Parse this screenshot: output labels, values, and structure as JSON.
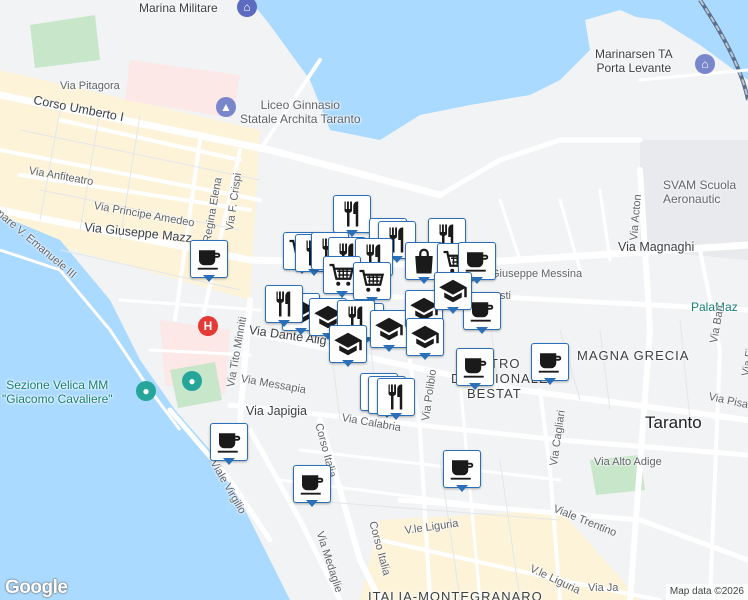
{
  "labels": {
    "marina_militare": "Marina Militare",
    "marinarsen_1": "Marinarsen TA",
    "marinarsen_2": "Porta Levante",
    "via_pitagora": "Via Pitagora",
    "corso_umberto": "Corso Umberto I",
    "liceo_1": "Liceo Ginnasio",
    "liceo_2": "Statale Archita Taranto",
    "svam_1": "SVAM Scuola",
    "svam_2": "Aeronautic",
    "via_anfiteatro": "Via Anfiteatro",
    "via_regina_elena": "Via Regina Elena",
    "via_f_crispi": "Via F. Crispi",
    "via_principe_amedeo": "Via Principe Amedeo",
    "via_acton": "Via Acton",
    "via_giuseppe_mazzini": "Via Giuseppe Mazz",
    "via_magnaghi": "Via Magnaghi",
    "lungomare": "mare V. Emanuele III",
    "via_giuseppe_messina": "Giuseppe Messina",
    "via_sti": "sti",
    "palamazzola": "PalaMaz",
    "via_dante_alighieri": "Via Dante Alig",
    "via_tito_minniti": "Via Tito Minniti",
    "via_bari": "Via Bari",
    "via_fiume": "Via Fiume",
    "magna_grecia": "MAGNA GRECIA",
    "teatro_1": "TRO",
    "teatro_2": "D NAZIONALE",
    "teatro_3": "BESTAT",
    "via_pisa": "Via Pisa",
    "sezione_velica_1": "Sezione Velica MM",
    "sezione_velica_2": "\"Giacomo Cavaliere\"",
    "via_messapia": "Via Messapia",
    "via_polibio": "Via Polibio",
    "via_cagliari": "Via Cagliari",
    "via_japigia": "Via Japigia",
    "via_calabria": "Via Calabria",
    "taranto": "Taranto",
    "via_alto_adige": "Via Alto Adige",
    "corso_italia": "Corso Italia",
    "corso_italia_2": "Corso Italia",
    "viale_virgilio": "Viale Virgilio",
    "viale_trentino": "Viale Trentino",
    "via_liguria_1": "V.le Liguria",
    "via_liguria_2": "V.le Liguria",
    "via_medaglie": "Via Medaglie",
    "italia_montegranaro": "ITALIA-MONTEGRANARO",
    "via_ja": "Via Ja"
  },
  "markers": [
    {
      "icon": "restaurant-icon"
    },
    {
      "icon": "restaurant-icon"
    },
    {
      "icon": "restaurant-icon"
    },
    {
      "icon": "restaurant-icon"
    },
    {
      "icon": "cafe-icon"
    },
    {
      "icon": "grocery-cart-icon"
    },
    {
      "icon": "restaurant-icon"
    },
    {
      "icon": "restaurant-icon"
    },
    {
      "icon": "restaurant-icon"
    },
    {
      "icon": "restaurant-icon"
    },
    {
      "icon": "shopping-bag-icon"
    },
    {
      "icon": "grocery-cart-icon"
    },
    {
      "icon": "cafe-icon"
    },
    {
      "icon": "grocery-cart-icon"
    },
    {
      "icon": "grocery-cart-icon"
    },
    {
      "icon": "school-icon"
    },
    {
      "icon": "restaurant-icon"
    },
    {
      "icon": "school-icon"
    },
    {
      "icon": "cafe-icon"
    },
    {
      "icon": "school-icon"
    },
    {
      "icon": "restaurant-icon"
    },
    {
      "icon": "school-icon"
    },
    {
      "icon": "school-icon"
    },
    {
      "icon": "school-icon"
    },
    {
      "icon": "school-icon"
    },
    {
      "icon": "school-icon"
    },
    {
      "icon": "cafe-icon"
    },
    {
      "icon": "cafe-icon"
    },
    {
      "icon": "restaurant-icon"
    },
    {
      "icon": "restaurant-icon"
    },
    {
      "icon": "restaurant-icon"
    },
    {
      "icon": "cafe-icon"
    },
    {
      "icon": "cafe-icon"
    },
    {
      "icon": "cafe-icon"
    }
  ],
  "colors": {
    "water": "#aadaff",
    "land": "#f1f3f4",
    "road": "#ffffff",
    "park": "#c8e6c9",
    "hospital": "#fce8e6",
    "marker_border": "#2a6fb7",
    "commercial": "#fdf3d9"
  },
  "google_logo": "Google",
  "attribution": "Map data ©2026"
}
